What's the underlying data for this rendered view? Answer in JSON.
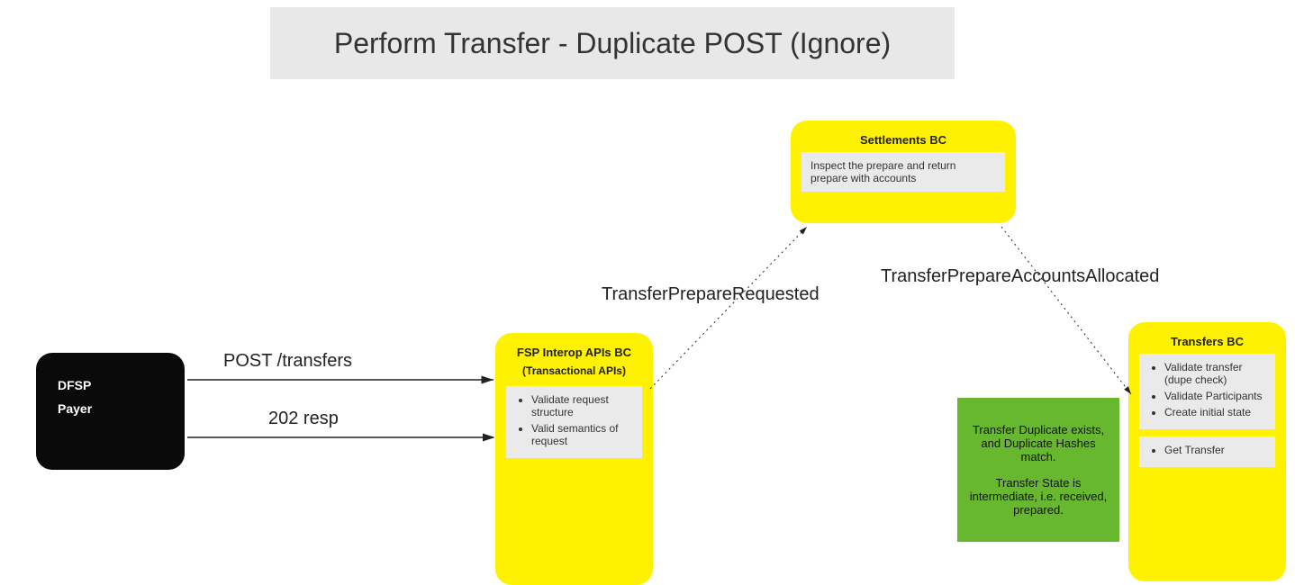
{
  "title": "Perform Transfer - Duplicate POST (Ignore)",
  "dfsp": {
    "line1": "DFSP",
    "line2": "Payer"
  },
  "arrows": {
    "post": "POST /transfers",
    "resp": "202 resp",
    "prepare": "TransferPrepareRequested",
    "alloc": "TransferPrepareAccountsAllocated"
  },
  "fsp": {
    "title": "FSP Interop APIs BC",
    "subtitle": "(Transactional APIs)",
    "items": [
      "Validate request structure",
      "Valid semantics of request"
    ]
  },
  "settlements": {
    "title": "Settlements BC",
    "desc": "Inspect the prepare and return prepare with accounts"
  },
  "green": {
    "p1": "Transfer Duplicate exists, and Duplicate Hashes match.",
    "p2": "Transfer State is intermediate, i.e. received, prepared."
  },
  "transfers": {
    "title": "Transfers BC",
    "items1": [
      "Validate transfer (dupe check)",
      "Validate Participants",
      "Create initial state"
    ],
    "items2": [
      "Get Transfer"
    ]
  }
}
